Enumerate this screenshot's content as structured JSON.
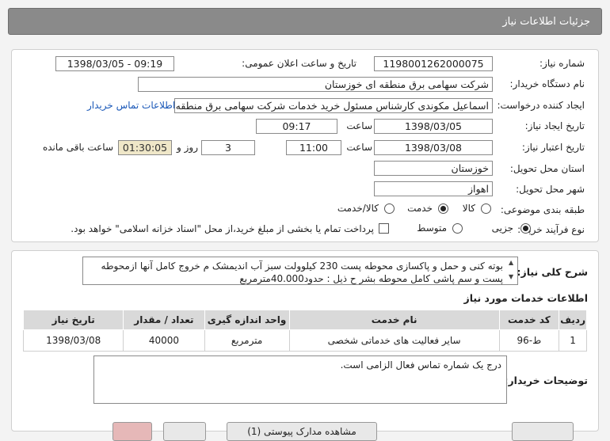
{
  "header": {
    "title": "جزئیات اطلاعات نیاز"
  },
  "form": {
    "need_number_label": "شماره نیاز:",
    "need_number": "1198001262000075",
    "announce_label": "تاریخ و ساعت اعلان عمومی:",
    "announce_value": "1398/03/05 - 09:19",
    "buyer_org_label": "نام دستگاه خریدار:",
    "buyer_org": "شرکت سهامی برق منطقه ای خوزستان",
    "requester_label": "ایجاد کننده درخواست:",
    "requester": "اسماعیل مکوندی کارشناس مسئول خرید خدمات شرکت سهامی برق منطقه ای خوزستان",
    "contact_link": "اطلاعات تماس خریدار",
    "created_label": "تاریخ ایجاد نیاز:",
    "created_date": "1398/03/05",
    "time_label": "ساعت",
    "created_time": "09:17",
    "validity_label": "تاریخ اعتبار نیاز:",
    "validity_date": "1398/03/08",
    "validity_time": "11:00",
    "days_value": "3",
    "days_label": "روز و",
    "remaining_time": "01:30:05",
    "remaining_label": "ساعت باقی مانده",
    "province_label": "استان محل تحویل:",
    "province": "خوزستان",
    "city_label": "شهر محل تحویل:",
    "city": "اهواز",
    "category_label": "طبقه بندی موضوعی:",
    "category_options": [
      "کالا",
      "خدمت",
      "کالا/خدمت"
    ],
    "category_selected": "خدمت",
    "process_label": "نوع فرآیند خرید :",
    "process_options": [
      "جزیی",
      "متوسط"
    ],
    "process_selected": "جزیی",
    "payment_note": "پرداخت تمام یا بخشی از مبلغ خرید،از محل \"اسناد خزانه اسلامی\" خواهد بود."
  },
  "summary": {
    "label": "شرح کلی نیاز:",
    "text": "بوته کنی و حمل و پاکسازی محوطه پست 230 کیلوولت سبز آب اندیمشک م خروج کامل آنها ازمحوطه پست و سم پاشی کامل محوطه بشر ح ذیل : حدود40.000مترمربع"
  },
  "services": {
    "title": "اطلاعات خدمات مورد نیاز",
    "columns": [
      "ردیف",
      "کد خدمت",
      "نام خدمت",
      "واحد اندازه گیری",
      "تعداد / مقدار",
      "تاریخ نیاز"
    ],
    "rows": [
      [
        "1",
        "ط-96",
        "سایر فعالیت های خدماتی شخصی",
        "مترمربع",
        "40000",
        "1398/03/08"
      ]
    ]
  },
  "buyer_notes": {
    "label": "توضیحات خریدار:",
    "text": "درج یک شماره تماس فعال الزامی است."
  },
  "footer": {
    "buttons": [
      "مشاهده مدارک پیوستی (1)"
    ]
  }
}
